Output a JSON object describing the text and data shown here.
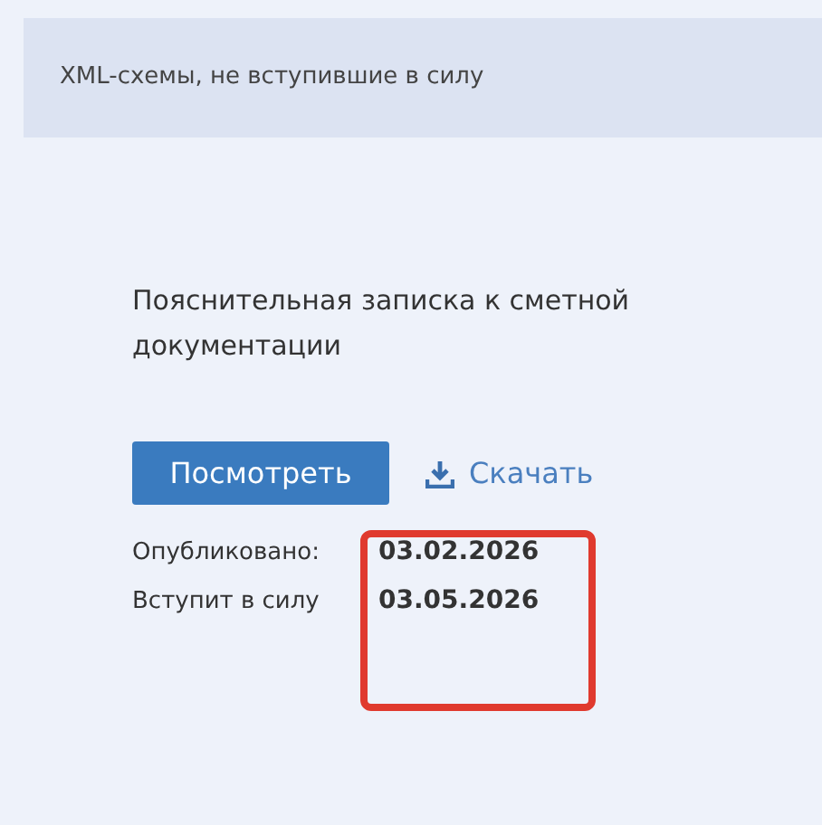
{
  "header": {
    "title": "XML-схемы, не вступившие в силу"
  },
  "document": {
    "title": "Пояснительная записка к сметной документации",
    "buttons": [
      {
        "kind": "primary",
        "label": "Посмотреть"
      },
      {
        "kind": "download",
        "label": "Скачать"
      }
    ],
    "fields": [
      {
        "label": "Опубликовано:",
        "value": "03.02.2026"
      },
      {
        "label": "Вступит в силу",
        "value": "03.05.2026"
      }
    ]
  }
}
